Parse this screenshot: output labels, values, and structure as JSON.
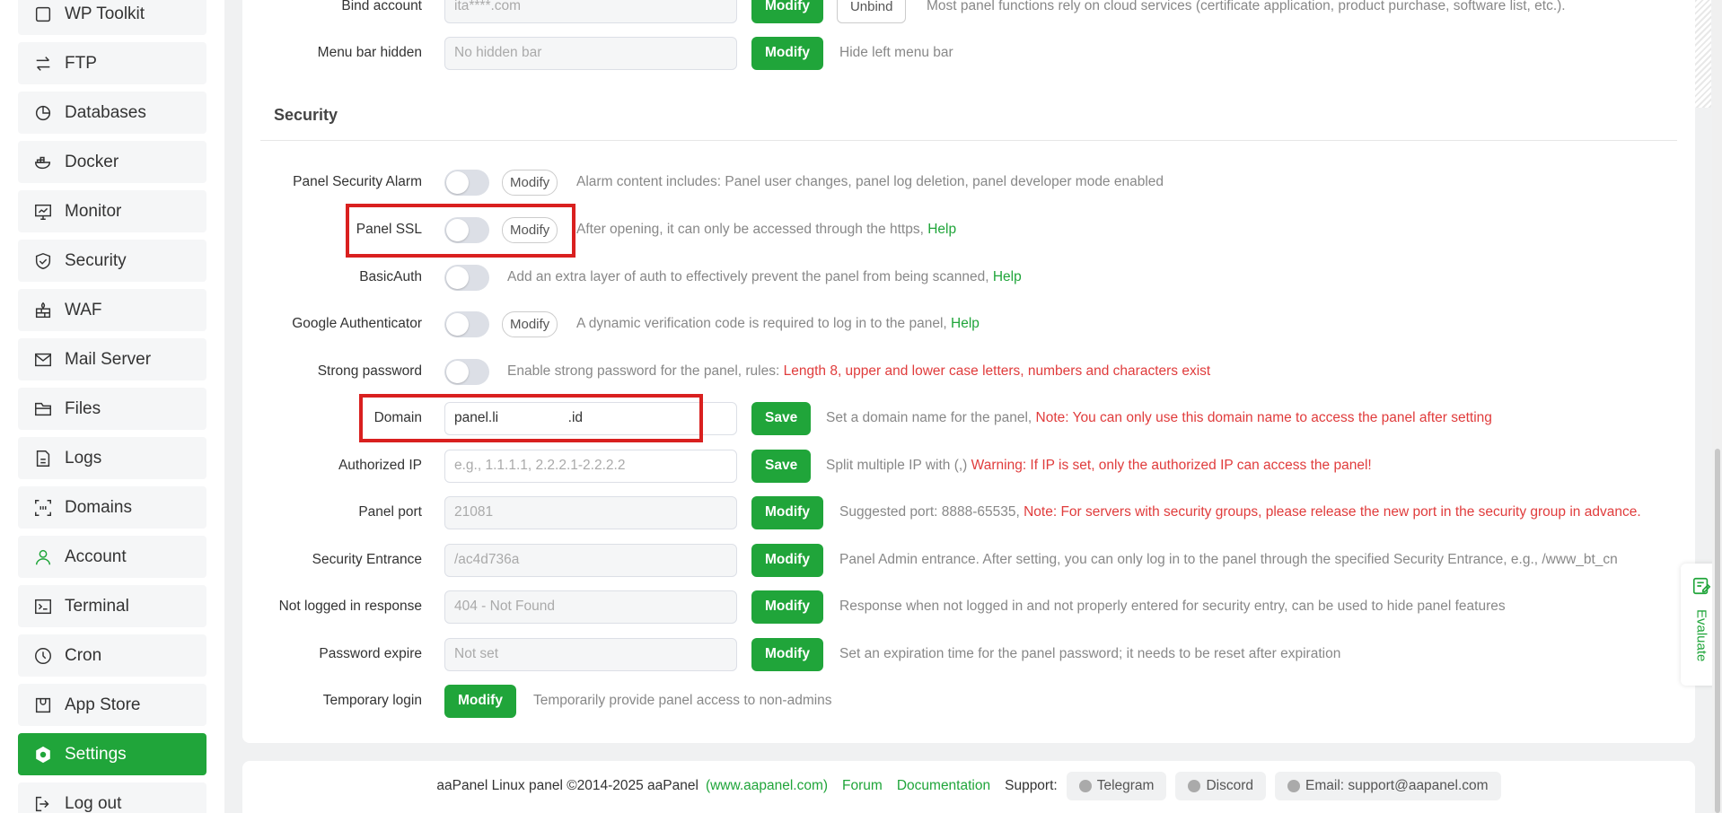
{
  "sidebar": {
    "items": [
      {
        "label": "WP Toolkit",
        "icon": "wordpress-icon"
      },
      {
        "label": "FTP",
        "icon": "transfer-icon"
      },
      {
        "label": "Databases",
        "icon": "pie-chart-icon"
      },
      {
        "label": "Docker",
        "icon": "docker-icon"
      },
      {
        "label": "Monitor",
        "icon": "monitor-icon"
      },
      {
        "label": "Security",
        "icon": "shield-icon"
      },
      {
        "label": "WAF",
        "icon": "firewall-icon"
      },
      {
        "label": "Mail Server",
        "icon": "mail-icon"
      },
      {
        "label": "Files",
        "icon": "folder-icon"
      },
      {
        "label": "Logs",
        "icon": "log-file-icon"
      },
      {
        "label": "Domains",
        "icon": "domain-icon"
      },
      {
        "label": "Account",
        "icon": "user-icon"
      },
      {
        "label": "Terminal",
        "icon": "terminal-icon"
      },
      {
        "label": "Cron",
        "icon": "clock-icon"
      },
      {
        "label": "App Store",
        "icon": "store-icon"
      },
      {
        "label": "Settings",
        "icon": "gear-icon",
        "active": true
      },
      {
        "label": "Log out",
        "icon": "logout-icon"
      }
    ]
  },
  "top": {
    "bind_account": {
      "label": "Bind account",
      "value": "ita****.com",
      "modify": "Modify",
      "unbind": "Unbind",
      "desc": "Most panel functions rely on cloud services (certificate application, product purchase, software list, etc.)."
    },
    "menu_bar": {
      "label": "Menu bar hidden",
      "placeholder": "No hidden bar",
      "modify": "Modify",
      "desc": "Hide left menu bar"
    }
  },
  "security": {
    "title": "Security",
    "alarm": {
      "label": "Panel Security Alarm",
      "modify": "Modify",
      "desc": "Alarm content includes: Panel user changes, panel log deletion, panel developer mode enabled"
    },
    "ssl": {
      "label": "Panel SSL",
      "modify": "Modify",
      "desc": "After opening, it can only be accessed through the https,",
      "help": "Help"
    },
    "basicauth": {
      "label": "BasicAuth",
      "desc": "Add an extra layer of auth to effectively prevent the panel from being scanned,",
      "help": "Help"
    },
    "google_auth": {
      "label": "Google Authenticator",
      "modify": "Modify",
      "desc": "A dynamic verification code is required to log in to the panel,",
      "help": "Help"
    },
    "strong_pw": {
      "label": "Strong password",
      "desc": "Enable strong password for the panel, rules:",
      "rule": "Length 8, upper and lower case letters, numbers and characters exist"
    },
    "domain": {
      "label": "Domain",
      "value": "panel.li                  .id",
      "save": "Save",
      "desc": "Set a domain name for the panel,",
      "note": "Note: You can only use this domain name to access the panel after setting"
    },
    "auth_ip": {
      "label": "Authorized IP",
      "placeholder": "e.g., 1.1.1.1, 2.2.2.1-2.2.2.2",
      "save": "Save",
      "desc": "Split multiple IP with (,)",
      "warning": "Warning: If IP is set, only the authorized IP can access the panel!"
    },
    "port": {
      "label": "Panel port",
      "value": "21081",
      "modify": "Modify",
      "desc": "Suggested port: 8888-65535,",
      "note": "Note: For servers with security groups, please release the new port in the security group in advance."
    },
    "entrance": {
      "label": "Security Entrance",
      "value": "/ac4d736a",
      "modify": "Modify",
      "desc": "Panel Admin entrance. After setting, you can only log in to the panel through the specified Security Entrance, e.g., /www_bt_cn"
    },
    "not_logged": {
      "label": "Not logged in response",
      "value": "404 - Not Found",
      "modify": "Modify",
      "desc": "Response when not logged in and not properly entered for security entry, can be used to hide panel features"
    },
    "pw_expire": {
      "label": "Password expire",
      "value": "Not set",
      "modify": "Modify",
      "desc": "Set an expiration time for the panel password; it needs to be reset after expiration"
    },
    "temp_login": {
      "label": "Temporary login",
      "modify": "Modify",
      "desc": "Temporarily provide panel access to non-admins"
    }
  },
  "footer": {
    "copyright": "aaPanel Linux panel ©2014-2025 aaPanel",
    "site": "(www.aapanel.com)",
    "forum": "Forum",
    "docs": "Documentation",
    "support": "Support:",
    "telegram": "Telegram",
    "discord": "Discord",
    "email": "Email: support@aapanel.com"
  },
  "evaluate": {
    "label": "Evaluate"
  },
  "colors": {
    "accent": "#20a53a",
    "warning": "#e03c3c",
    "highlight": "#d9201f"
  }
}
